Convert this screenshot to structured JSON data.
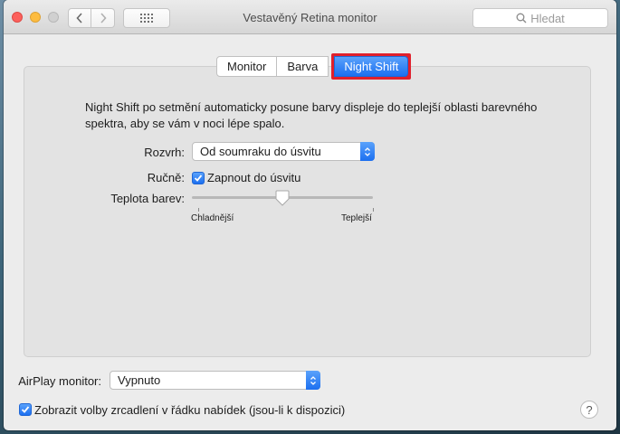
{
  "window": {
    "title": "Vestavěný Retina monitor",
    "search_placeholder": "Hledat"
  },
  "tabs": [
    "Monitor",
    "Barva",
    "Night Shift"
  ],
  "active_tab": "Night Shift",
  "highlight_color": "#e0202c",
  "accent_color": "#1c6ff0",
  "description": "Night Shift po setmění automaticky posune barvy displeje do teplejší oblasti barevného spektra, aby se vám v noci lépe spalo.",
  "schedule": {
    "label": "Rozvrh:",
    "value": "Od soumraku do úsvitu"
  },
  "manual": {
    "label": "Ručně:",
    "checkbox_label": "Zapnout do úsvitu",
    "checked": true
  },
  "temperature": {
    "label": "Teplota barev:",
    "min_label": "Chladnější",
    "max_label": "Teplejší",
    "value_fraction": 0.5
  },
  "airplay": {
    "label": "AirPlay monitor:",
    "value": "Vypnuto"
  },
  "mirroring": {
    "label": "Zobrazit volby zrcadlení v řádku nabídek (jsou-li k dispozici)",
    "checked": true
  },
  "help": "?"
}
